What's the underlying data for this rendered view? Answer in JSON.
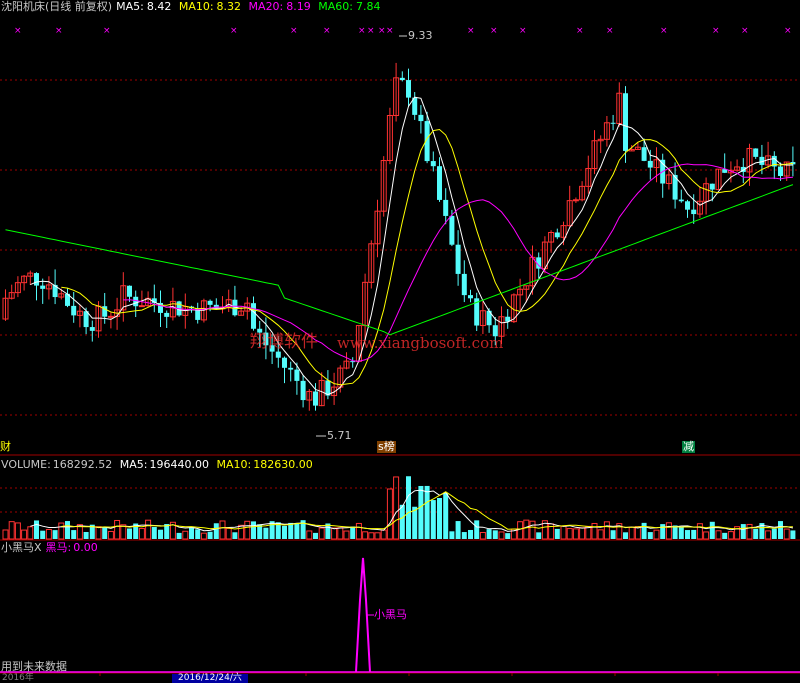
{
  "colors": {
    "bg": "#000000",
    "up": "#ff3232",
    "down": "#54fcfc",
    "ma5": "#ffffff",
    "ma10": "#ffff00",
    "ma20": "#ff00ff",
    "ma60": "#00ff00",
    "grid": "#a00000",
    "text": "#c8c8c8",
    "watermark": "#ff3232",
    "signal": "#ff00ff"
  },
  "price_header": {
    "title": "沈阳机床(日线 前复权)",
    "ma5_label": "MA5:",
    "ma5_value": "8.42",
    "ma10_label": "MA10:",
    "ma10_value": "8.32",
    "ma20_label": "MA20:",
    "ma20_value": "8.19",
    "ma60_label": "MA60:",
    "ma60_value": "7.84"
  },
  "price_annotations": {
    "high": "9.33",
    "low": "5.71"
  },
  "event_markers": [
    {
      "text": "财",
      "icon": "finance-report-marker"
    },
    {
      "text": "s榜",
      "icon": "dragon-tiger-list-marker"
    },
    {
      "text": "减",
      "icon": "shareholder-reduction-marker"
    }
  ],
  "watermark": {
    "brand": "翔博软件",
    "url": "www.xiangbosoft.com"
  },
  "volume_header": {
    "label": "VOLUME:",
    "value": "168292.52",
    "ma5_label": "MA5:",
    "ma5_value": "196440.00",
    "ma10_label": "MA10:",
    "ma10_value": "182630.00"
  },
  "indicator_header": {
    "name": "小黑马X",
    "signal_label": "黑马:",
    "signal_value": "0.00"
  },
  "indicator_annotation": "小黑马",
  "indicator_warning": "用到未来数据",
  "date_axis": {
    "left": "2016年",
    "cursor": "2016/12/24/六"
  },
  "chart_data": {
    "type": "candlestick",
    "price_range": [
      5.5,
      9.5
    ],
    "volume_max": 460000,
    "ma_periods": [
      5,
      10,
      20,
      60
    ]
  }
}
